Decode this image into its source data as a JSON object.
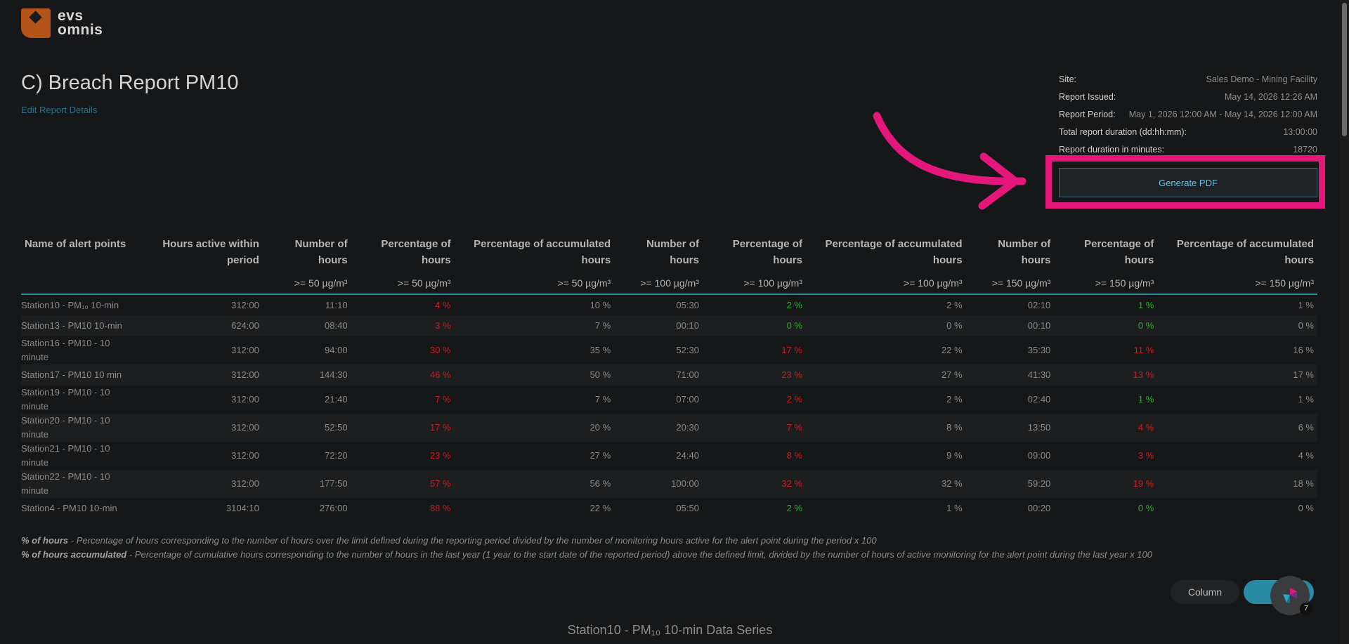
{
  "logo": {
    "line1": "evs",
    "line2": "omnis"
  },
  "page": {
    "title": "C) Breach Report PM10",
    "edit_link": "Edit Report Details"
  },
  "meta": [
    {
      "label": "Site:",
      "value": "Sales Demo - Mining Facility"
    },
    {
      "label": "Report Issued:",
      "value": "May 14, 2026 12:26 AM"
    },
    {
      "label": "Report Period:",
      "value": "May 1, 2026 12:00 AM - May 14, 2026 12:00 AM"
    },
    {
      "label": "Total report duration (dd:hh:mm):",
      "value": "13:00:00"
    },
    {
      "label": "Report duration in minutes:",
      "value": "18720"
    }
  ],
  "generate_pdf_label": "Generate PDF",
  "table": {
    "headers": [
      "Name of alert points",
      "Hours active within period",
      "Number of hours",
      "Percentage of hours",
      "Percentage of accumulated hours",
      "Number of hours",
      "Percentage of hours",
      "Percentage of accumulated hours",
      "Number of hours",
      "Percentage of hours",
      "Percentage of accumulated hours"
    ],
    "units": [
      "",
      "",
      ">= 50 µg/m³",
      ">= 50 µg/m³",
      ">= 50 µg/m³",
      ">= 100 µg/m³",
      ">= 100 µg/m³",
      ">= 100 µg/m³",
      ">= 150 µg/m³",
      ">= 150 µg/m³",
      ">= 150 µg/m³"
    ],
    "rows": [
      [
        "Station10 - PM₁₀ 10-min",
        "312:00",
        "11:10",
        "4 %",
        "10 %",
        "05:30",
        "2 %",
        "2 %",
        "02:10",
        "1 %",
        "1 %"
      ],
      [
        "Station13 - PM10 10-min",
        "624:00",
        "08:40",
        "3 %",
        "7 %",
        "00:10",
        "0 %",
        "0 %",
        "00:10",
        "0 %",
        "0 %"
      ],
      [
        "Station16 - PM10 - 10 minute",
        "312:00",
        "94:00",
        "30 %",
        "35 %",
        "52:30",
        "17 %",
        "22 %",
        "35:30",
        "11 %",
        "16 %"
      ],
      [
        "Station17 - PM10 10 min",
        "312:00",
        "144:30",
        "46 %",
        "50 %",
        "71:00",
        "23 %",
        "27 %",
        "41:30",
        "13 %",
        "17 %"
      ],
      [
        "Station19 - PM10 - 10 minute",
        "312:00",
        "21:40",
        "7 %",
        "7 %",
        "07:00",
        "2 %",
        "2 %",
        "02:40",
        "1 %",
        "1 %"
      ],
      [
        "Station20 - PM10 - 10 minute",
        "312:00",
        "52:50",
        "17 %",
        "20 %",
        "20:30",
        "7 %",
        "8 %",
        "13:50",
        "4 %",
        "6 %"
      ],
      [
        "Station21 - PM10 - 10 minute",
        "312:00",
        "72:20",
        "23 %",
        "27 %",
        "24:40",
        "8 %",
        "9 %",
        "09:00",
        "3 %",
        "4 %"
      ],
      [
        "Station22 - PM10 - 10 minute",
        "312:00",
        "177:50",
        "57 %",
        "56 %",
        "100:00",
        "32 %",
        "32 %",
        "59:20",
        "19 %",
        "18 %"
      ],
      [
        "Station4 - PM10 10-min",
        "3104:10",
        "276:00",
        "88 %",
        "22 %",
        "05:50",
        "2 %",
        "1 %",
        "00:20",
        "0 %",
        "0 %"
      ]
    ],
    "row_colors": [
      [
        "",
        "",
        "",
        "red",
        "",
        "",
        "green",
        "",
        "",
        "green",
        ""
      ],
      [
        "",
        "",
        "",
        "red",
        "",
        "",
        "green",
        "",
        "",
        "green",
        ""
      ],
      [
        "",
        "",
        "",
        "red",
        "",
        "",
        "red",
        "",
        "",
        "red",
        ""
      ],
      [
        "",
        "",
        "",
        "red",
        "",
        "",
        "red",
        "",
        "",
        "red",
        ""
      ],
      [
        "",
        "",
        "",
        "red",
        "",
        "",
        "red",
        "",
        "",
        "green",
        ""
      ],
      [
        "",
        "",
        "",
        "red",
        "",
        "",
        "red",
        "",
        "",
        "red",
        ""
      ],
      [
        "",
        "",
        "",
        "red",
        "",
        "",
        "red",
        "",
        "",
        "red",
        ""
      ],
      [
        "",
        "",
        "",
        "red",
        "",
        "",
        "red",
        "",
        "",
        "red",
        ""
      ],
      [
        "",
        "",
        "",
        "red",
        "",
        "",
        "green",
        "",
        "",
        "green",
        ""
      ]
    ]
  },
  "footnotes": {
    "hours_term": "% of hours",
    "hours_text": " - Percentage of hours corresponding to the number of hours over the limit defined during the reporting period divided by the number of monitoring hours active for the alert point during the period x 100",
    "accum_term": "% of hours accumulated",
    "accum_text": " - Percentage of cumulative hours corresponding to the number of hours in the last year (1 year to the start date of the reported period) above the defined limit, divided by the number of hours of active monitoring for the alert point during the last year x 100"
  },
  "buttons": {
    "column": "Column"
  },
  "help_badge": "7",
  "series_title": "Station10 - PM₁₀ 10-min Data Series",
  "colors": {
    "accent": "#2f8fa5",
    "highlight": "#e5177a",
    "red": "#c81f1f",
    "green": "#27b42a",
    "brand": "#b4541b"
  }
}
